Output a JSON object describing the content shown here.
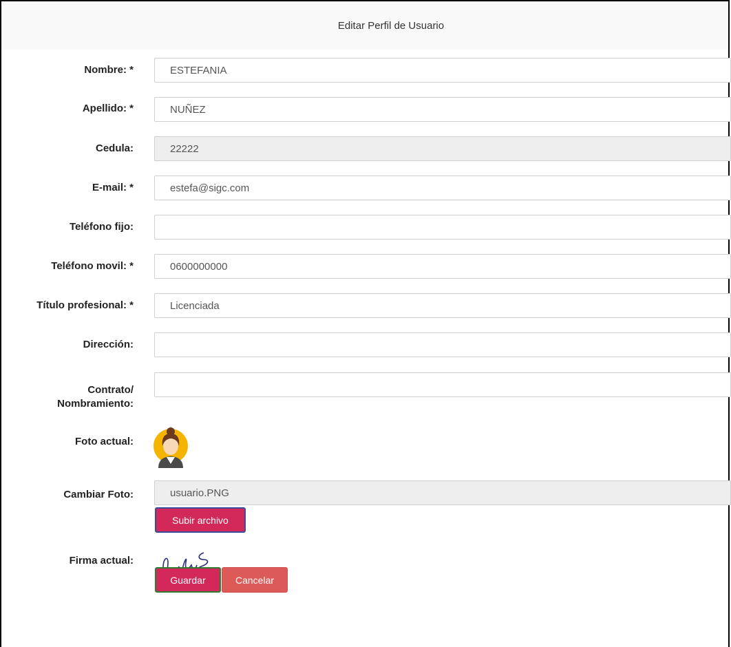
{
  "header": {
    "title": "Editar Perfil de Usuario"
  },
  "form": {
    "nombre": {
      "label": "Nombre: *",
      "value": "ESTEFANIA"
    },
    "apellido": {
      "label": "Apellido: *",
      "value": "NUÑEZ"
    },
    "cedula": {
      "label": "Cedula:",
      "value": "22222"
    },
    "email": {
      "label": "E-mail: *",
      "value": "estefa@sigc.com"
    },
    "telefono_fijo": {
      "label": "Teléfono fijo:",
      "value": ""
    },
    "telefono_movil": {
      "label": "Teléfono movil: *",
      "value": "0600000000"
    },
    "titulo": {
      "label": "Título profesional: *",
      "value": "Licenciada"
    },
    "direccion": {
      "label": "Dirección:",
      "value": ""
    },
    "contrato": {
      "label_line1": "Contrato/",
      "label_line2": "Nombramiento:",
      "value": ""
    },
    "foto_actual": {
      "label": "Foto actual:"
    },
    "cambiar_foto": {
      "label": "Cambiar Foto:",
      "value": "usuario.PNG",
      "button": "Subir archivo"
    },
    "firma_actual": {
      "label": "Firma actual:"
    }
  },
  "actions": {
    "save": "Guardar",
    "cancel": "Cancelar"
  },
  "colors": {
    "primary_button": "#d2285a",
    "cancel_button": "#dc5a57",
    "disabled_field": "#eeeeee"
  }
}
